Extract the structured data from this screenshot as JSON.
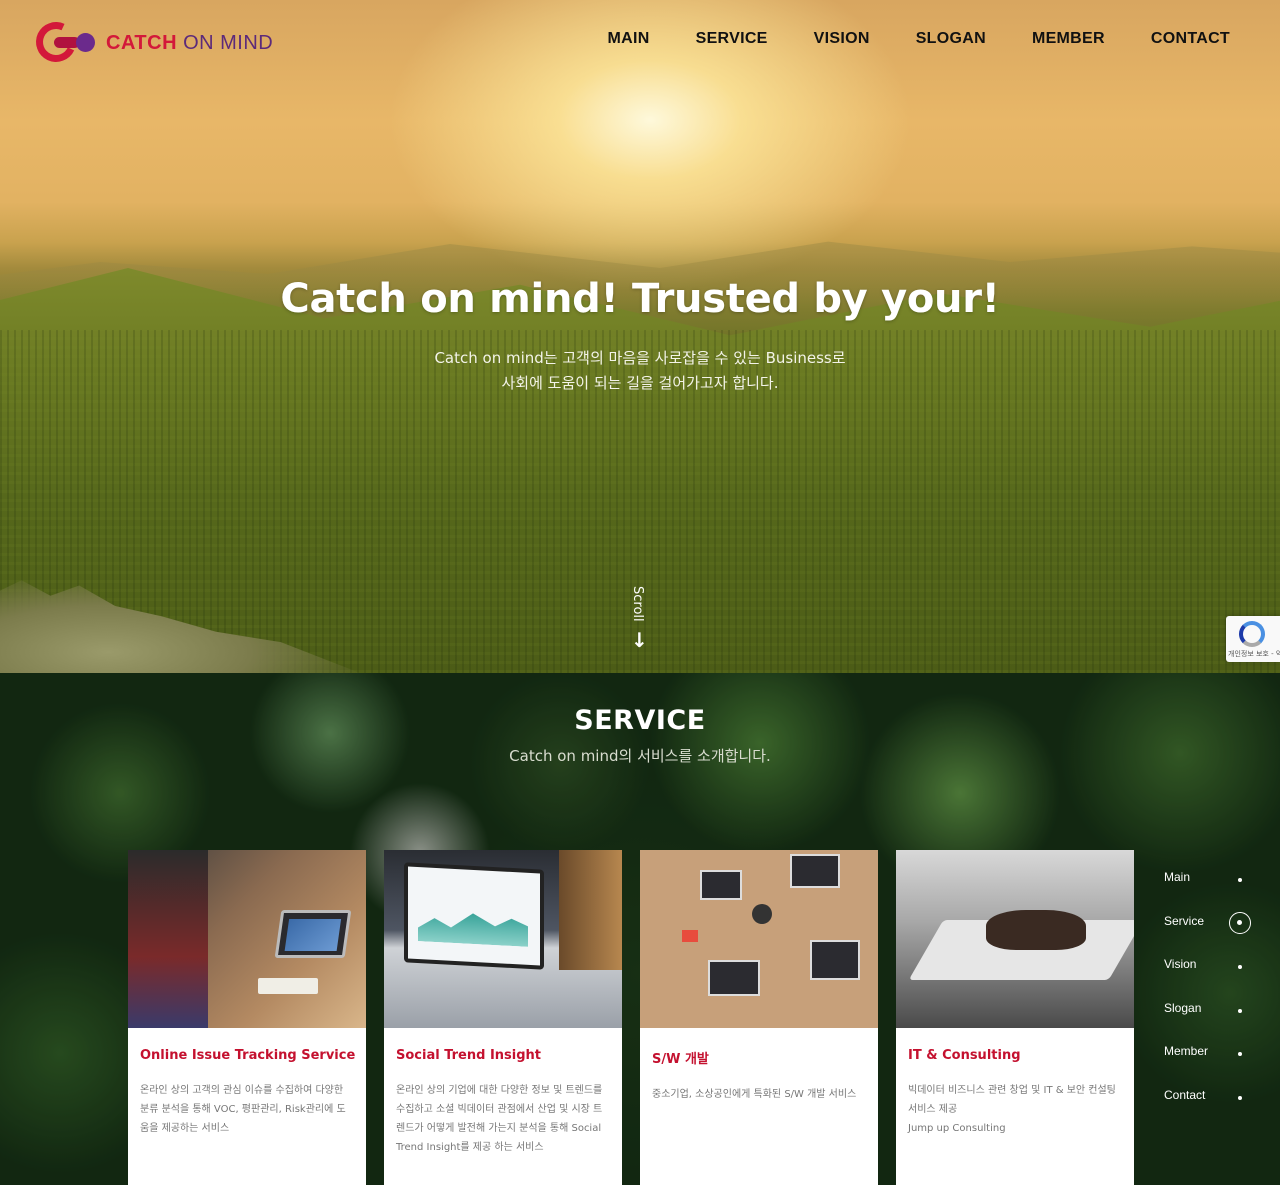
{
  "header": {
    "logo_bold": "CATCH",
    "logo_light": "ON MIND",
    "nav": [
      "MAIN",
      "SERVICE",
      "VISION",
      "SLOGAN",
      "MEMBER",
      "CONTACT"
    ]
  },
  "hero": {
    "title": "Catch on mind! Trusted by your!",
    "subtitle_line1": "Catch on mind는 고객의 마음을 사로잡을 수 있는 Business로",
    "subtitle_line2": "사회에 도움이 되는 길을 걸어가고자 합니다.",
    "scroll_label": "Scroll"
  },
  "recaptcha": {
    "text": "개인정보 보호 - 약관"
  },
  "service": {
    "title": "SERVICE",
    "subtitle": "Catch on mind의 서비스를 소개합니다.",
    "cards": [
      {
        "title": "Online Issue Tracking Service",
        "text": "온라인 상의 고객의 관심 이슈를 수집하여 다양한 분류 분석을 통해 VOC, 평판관리, Risk관리에 도움을 제공하는 서비스"
      },
      {
        "title": "Social Trend Insight",
        "text": "온라인 상의 기업에 대한 다양한 정보 및 트렌드를 수집하고 소셜 빅데이터 관점에서 산업 및 시장 트렌드가 어떻게 발전해 가는지 분석을 통해 Social Trend Insight를 제공 하는 서비스"
      },
      {
        "title": "S/W 개발",
        "text": "중소기업, 소상공인에게 특화된 S/W 개발 서비스"
      },
      {
        "title": "IT & Consulting",
        "text": "빅데이터 비즈니스 관련 창업 및 IT & 보안 컨설팅 서비스 제공",
        "text2": "Jump up Consulting"
      }
    ]
  },
  "sidenav": {
    "items": [
      "Main",
      "Service",
      "Vision",
      "Slogan",
      "Member",
      "Contact"
    ],
    "active": "Service"
  },
  "colors": {
    "brand_red": "#d3183a",
    "brand_purple": "#6b2a8c",
    "card_title": "#c4112f"
  }
}
